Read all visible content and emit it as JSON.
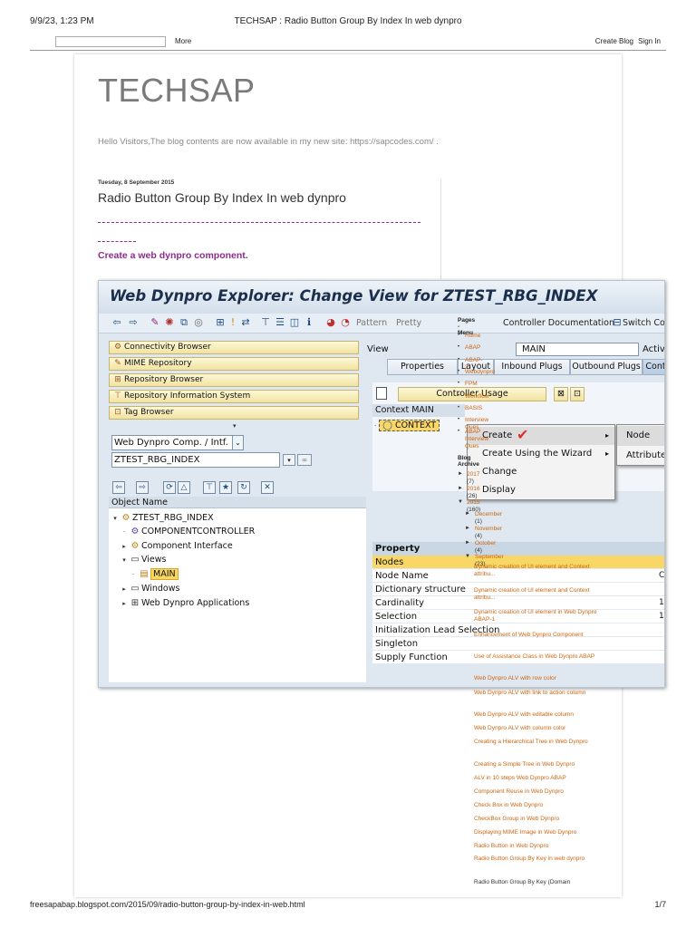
{
  "print": {
    "date": "9/9/23, 1:23 PM",
    "title": "TECHSAP : Radio Button Group By Index In web dynpro",
    "url": "freesapabap.blogspot.com/2015/09/radio-button-group-by-index-in-web.html",
    "page": "1/7"
  },
  "navbar": {
    "more": "More",
    "create_blog": "Create Blog",
    "sign_in": "Sign In"
  },
  "blog": {
    "title": "TECHSAP",
    "description": "Hello Visitors,The blog contents are now available in my new site: https://sapcodes.com/ ."
  },
  "post": {
    "date": "Tuesday, 8 September 2015",
    "title": "Radio Button Group By Index In web dynpro",
    "step": "Create a web dynpro component."
  },
  "sap": {
    "window_title": "Web Dynpro Explorer: Change View for ZTEST_RBG_INDEX",
    "toolbar": {
      "pattern": "Pattern",
      "pretty": "Pretty",
      "controller_doc": "Controller Documentation",
      "switch": "Switch Co"
    },
    "left_buttons": [
      "Connectivity Browser",
      "MIME Repository",
      "Repository Browser",
      "Repository Information System",
      "Tag Browser"
    ],
    "object_type": "Web Dynpro Comp. / Intf.",
    "object_name": "ZTEST_RBG_INDEX",
    "object_header": "Object Name",
    "tree": [
      "ZTEST_RBG_INDEX",
      "COMPONENTCONTROLLER",
      "Component Interface",
      "Views",
      "MAIN",
      "Windows",
      "Web Dynpro Applications"
    ],
    "view_label": "View",
    "view_value": "MAIN",
    "active_label": "Active",
    "tabs": [
      "Properties",
      "Layout",
      "Inbound Plugs",
      "Outbound Plugs",
      "Context"
    ],
    "controller_usage": "Controller Usage",
    "context_header": "Context MAIN",
    "context_node": "CONTEXT",
    "menu": [
      "Create",
      "Create Using the Wizard",
      "Change",
      "Display"
    ],
    "submenu": [
      "Node",
      "Attribute"
    ],
    "property_header": "Property",
    "properties": [
      "Nodes",
      "Node Name",
      "Dictionary structure",
      "Cardinality",
      "Selection",
      "Initialization Lead Selection",
      "Singleton",
      "Supply Function"
    ],
    "prop_values": [
      "C",
      "1",
      "1"
    ]
  },
  "sidebar": {
    "pages_heading": "Pages - Menu",
    "pages": [
      "Home",
      "ABAP",
      "ABAP-2",
      "Webdynpro",
      "FPM",
      "Workflow",
      "BASIS",
      "Interview Ques",
      "ABAP Interview Ques"
    ],
    "archive_heading": "Blog Archive",
    "years": [
      {
        "label": "2017",
        "count": "(7)"
      },
      {
        "label": "2016",
        "count": "(26)"
      },
      {
        "label": "2015",
        "count": "(160)"
      }
    ],
    "months": [
      {
        "label": "December",
        "count": "(1)"
      },
      {
        "label": "November",
        "count": "(4)"
      },
      {
        "label": "October",
        "count": "(4)"
      },
      {
        "label": "September",
        "count": "(23)"
      }
    ],
    "posts": [
      "Dynamic creation of UI element and Context attribu...",
      "Dynamic creation of UI element and Context attribu...",
      "Dynamic creation of UI element in Web Dynpro ABAP-1",
      "Enhancement of Web Dynpro Component",
      "Use of Assistance Class in Web Dynpro ABAP",
      "Web Dynpro ALV with row color",
      "Web Dynpro ALV with link to action column",
      "Web Dynpro ALV with editable column",
      "Web Dynpro ALV with column color",
      "Creating a Hierarchical Tree in Web Dynpro",
      "Creating a Simple Tree in Web Dynpro",
      "ALV in 10 steps Web Dynpro ABAP",
      "Component Reuse in Web Dynpro",
      "Check Box in Web Dynpro",
      "CheckBox Group in Web Dynpro",
      "Displaying MIME Image in Web Dynpro",
      "Radio Button in Web Dynpro",
      "Radio Button Group By Key in web dynpro",
      "Radio Button Group By Key (Domain"
    ]
  }
}
